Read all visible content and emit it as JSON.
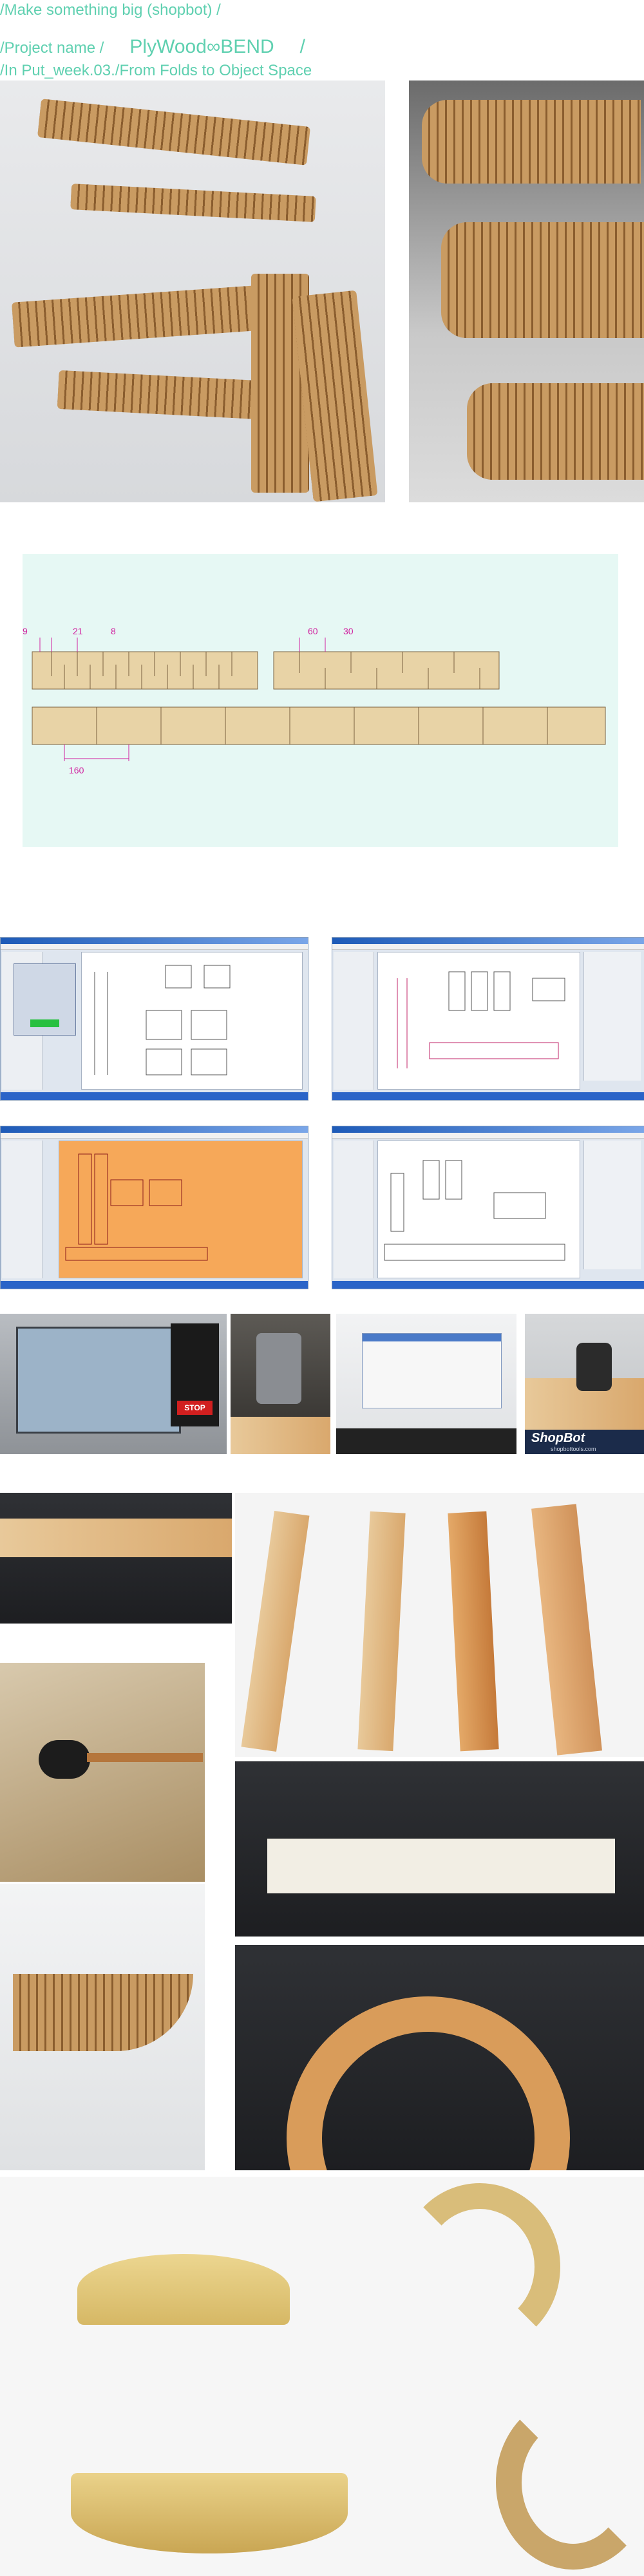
{
  "header": {
    "line1": "/Make something big (shopbot) /",
    "line2_prefix": "/Project name /",
    "line2_project": "PlyWood∞BEND",
    "line2_suffix": "/",
    "line3": "/In Put_week.03./From Folds to Object Space"
  },
  "drawing": {
    "dim_9": "9",
    "dim_21": "21",
    "dim_8": "8",
    "dim_60": "60",
    "dim_30": "30",
    "dim_160": "160"
  },
  "machine": {
    "stop_label": "STOP",
    "brand": "ShopBot",
    "site": "shopbottools.com"
  },
  "colors": {
    "header_text": "#5fd0b0",
    "drawing_bg": "#e6f8f4",
    "dimension": "#d0209f",
    "plywood": "#e8d3a6"
  }
}
